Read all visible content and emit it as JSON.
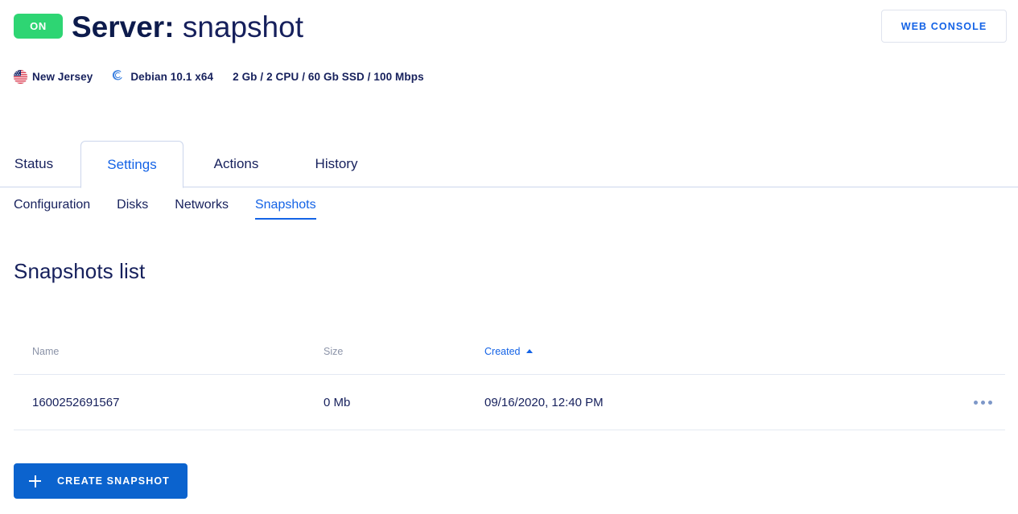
{
  "header": {
    "status_badge": "ON",
    "title_label": "Server:",
    "title_value": "snapshot",
    "web_console_label": "WEB CONSOLE",
    "status_color": "#2ed573",
    "accent_color": "#1463e6",
    "title_color": "#16205c"
  },
  "meta": {
    "location": "New Jersey",
    "location_icon": "us-flag-icon",
    "os": "Debian 10.1 x64",
    "os_icon": "debian-logo-icon",
    "specs": "2 Gb / 2 CPU / 60 Gb SSD / 100 Mbps"
  },
  "tabs": [
    {
      "label": "Status",
      "active": false
    },
    {
      "label": "Settings",
      "active": true
    },
    {
      "label": "Actions",
      "active": false
    },
    {
      "label": "History",
      "active": false
    }
  ],
  "subtabs": [
    {
      "label": "Configuration",
      "active": false
    },
    {
      "label": "Disks",
      "active": false
    },
    {
      "label": "Networks",
      "active": false
    },
    {
      "label": "Snapshots",
      "active": true
    }
  ],
  "main": {
    "section_heading": "Snapshots list",
    "table": {
      "columns": [
        {
          "label": "Name",
          "sorted": false
        },
        {
          "label": "Size",
          "sorted": false
        },
        {
          "label": "Created",
          "sorted": true,
          "sort_direction": "asc"
        }
      ],
      "rows": [
        {
          "name": "1600252691567",
          "size": "0 Mb",
          "created": "09/16/2020, 12:40 PM"
        }
      ]
    },
    "create_button_label": "CREATE SNAPSHOT"
  }
}
